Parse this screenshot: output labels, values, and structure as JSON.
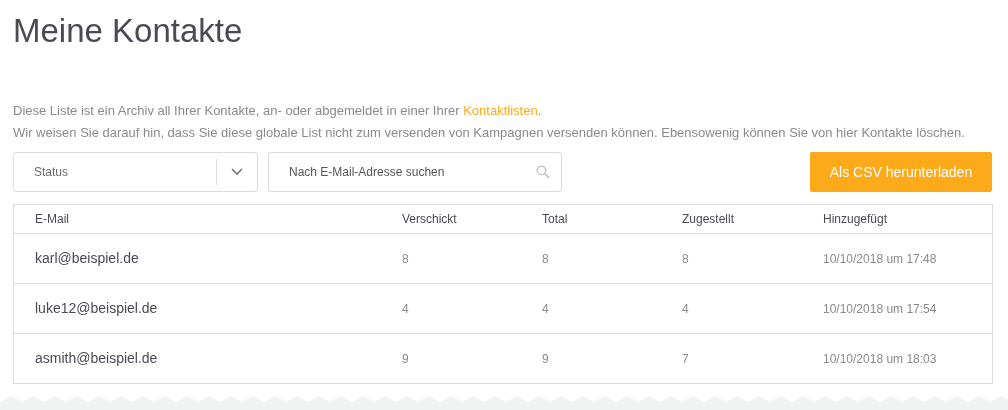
{
  "title": "Meine Kontakte",
  "intro": {
    "line_1": "Diese Liste ist ein Archiv all Ihrer Kontakte, an- oder abgemeldet in einer Ihrer ",
    "link": "Kontaktlisten",
    "line_1_end": ".",
    "line_2": "Wir weisen Sie darauf hin, dass Sie diese globale List nicht zum versenden von Kampagnen versenden können. Ebensowenig können Sie von hier Kontakte löschen."
  },
  "status_select": {
    "placeholder": "Status"
  },
  "search": {
    "placeholder": "Nach E-Mail-Adresse suchen"
  },
  "download_button": "Als CSV herunterladen",
  "table": {
    "columns": [
      "E-Mail",
      "Verschickt",
      "Total",
      "Zugestellt",
      "Hinzugefügt"
    ],
    "rows": [
      [
        "karl@beispiel.de",
        "8",
        "8",
        "8",
        "10/10/2018 um 17:48"
      ],
      [
        "luke12@beispiel.de",
        "4",
        "4",
        "4",
        "10/10/2018 um 17:54"
      ],
      [
        "asmith@beispiel.de",
        "9",
        "9",
        "7",
        "10/10/2018 um 18:03"
      ]
    ]
  }
}
